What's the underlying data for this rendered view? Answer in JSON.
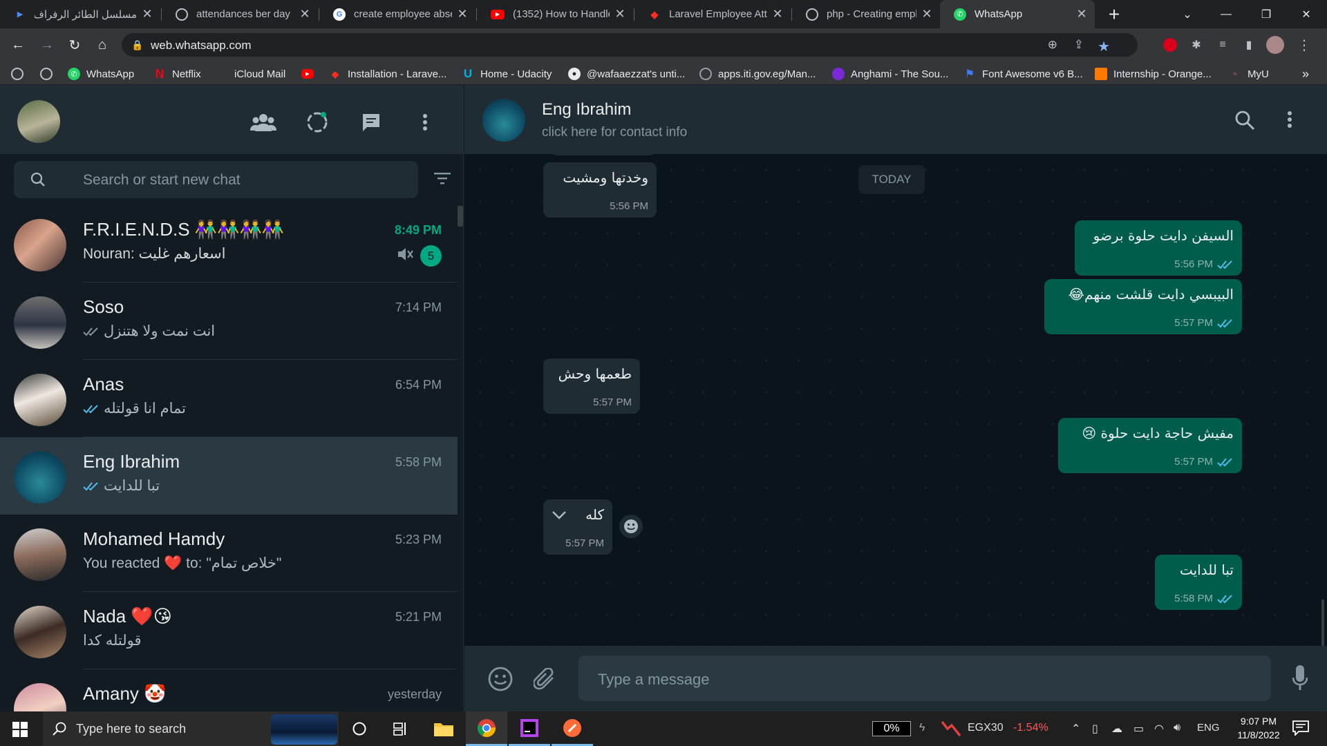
{
  "browser": {
    "tabs": [
      {
        "title": "مسلسل الطائر الرفراف",
        "icon": "media-icon"
      },
      {
        "title": "attendances ber day",
        "icon": "globe-icon"
      },
      {
        "title": "create employee abse",
        "icon": "google-icon"
      },
      {
        "title": "(1352) How to Handle",
        "icon": "youtube-icon"
      },
      {
        "title": "Laravel Employee Atte",
        "icon": "laravel-icon"
      },
      {
        "title": "php - Creating emplo",
        "icon": "globe-icon"
      },
      {
        "title": "WhatsApp",
        "icon": "whatsapp-icon"
      }
    ],
    "url": "web.whatsapp.com",
    "bookmarks": [
      {
        "label": "WhatsApp",
        "color": "#25d366"
      },
      {
        "label": "Netflix",
        "color": "#e50914"
      },
      {
        "label": "iCloud Mail",
        "color": "#c8c8c8"
      },
      {
        "label": "Installation - Larave...",
        "color": "#ff2d20"
      },
      {
        "label": "Home - Udacity",
        "color": "#02b3e4"
      },
      {
        "label": "@wafaaezzat's unti...",
        "color": "#e8eaed"
      },
      {
        "label": "apps.iti.gov.eg/Man...",
        "color": "#9aa0a6"
      },
      {
        "label": "Anghami - The Sou...",
        "color": "#7a2ad8"
      },
      {
        "label": "Font Awesome v6 B...",
        "color": "#3e7bf7"
      },
      {
        "label": "Internship - Orange...",
        "color": "#ff7900"
      },
      {
        "label": "MyU",
        "color": "#a0a0a0"
      }
    ]
  },
  "sidebar": {
    "search_placeholder": "Search or start new chat",
    "chats": [
      {
        "name": "F.R.I.E.N.D.S 👫👫👫👫",
        "last": "Nouran: اسعارهم غليت",
        "time": "8:49 PM",
        "unread": "5",
        "muted": true
      },
      {
        "name": "Soso",
        "last": "انت نمت ولا هتنزل",
        "time": "7:14 PM"
      },
      {
        "name": "Anas",
        "last": "تمام انا قولتله",
        "time": "6:54 PM"
      },
      {
        "name": "Eng Ibrahim",
        "last": "تبا للدايت",
        "time": "5:58 PM"
      },
      {
        "name": "Mohamed Hamdy",
        "last": "You reacted ❤️ to: \"خلاص تمام\"",
        "time": "5:23 PM"
      },
      {
        "name": "Nada ❤️😘",
        "last": "قولتله كدا",
        "time": "5:21 PM"
      },
      {
        "name": "Amany 🤡",
        "last": "",
        "time": "yesterday"
      }
    ]
  },
  "conversation": {
    "contact_name": "Eng Ibrahim",
    "subtitle": "click here for contact info",
    "date_chip": "TODAY",
    "composer_placeholder": "Type a message",
    "messages": [
      {
        "dir": "in",
        "text": "وخدتها ومشيت",
        "time": "5:56 PM"
      },
      {
        "dir": "out",
        "text": "السيفن دايت حلوة برضو",
        "time": "5:56 PM"
      },
      {
        "dir": "out",
        "text": "البيبسي دايت قلشت منهم😂",
        "time": "5:57 PM"
      },
      {
        "dir": "in",
        "text": "طعمها وحش",
        "time": "5:57 PM"
      },
      {
        "dir": "out",
        "text": "مفيش حاجة دايت حلوة 😢",
        "time": "5:57 PM"
      },
      {
        "dir": "in",
        "text": "كله",
        "time": "5:57 PM"
      },
      {
        "dir": "out",
        "text": "تبا للدايت",
        "time": "5:58 PM"
      }
    ]
  },
  "taskbar": {
    "search_placeholder": "Type here to search",
    "battery": "0%",
    "stock_name": "EGX30",
    "stock_change": "-1.54%",
    "language": "ENG",
    "time": "9:07 PM",
    "date": "11/8/2022",
    "colors": {
      "accent": "#00a884",
      "outgoing": "#005c4b",
      "incoming": "#202c33",
      "stock_down": "#ff5a5a"
    }
  }
}
